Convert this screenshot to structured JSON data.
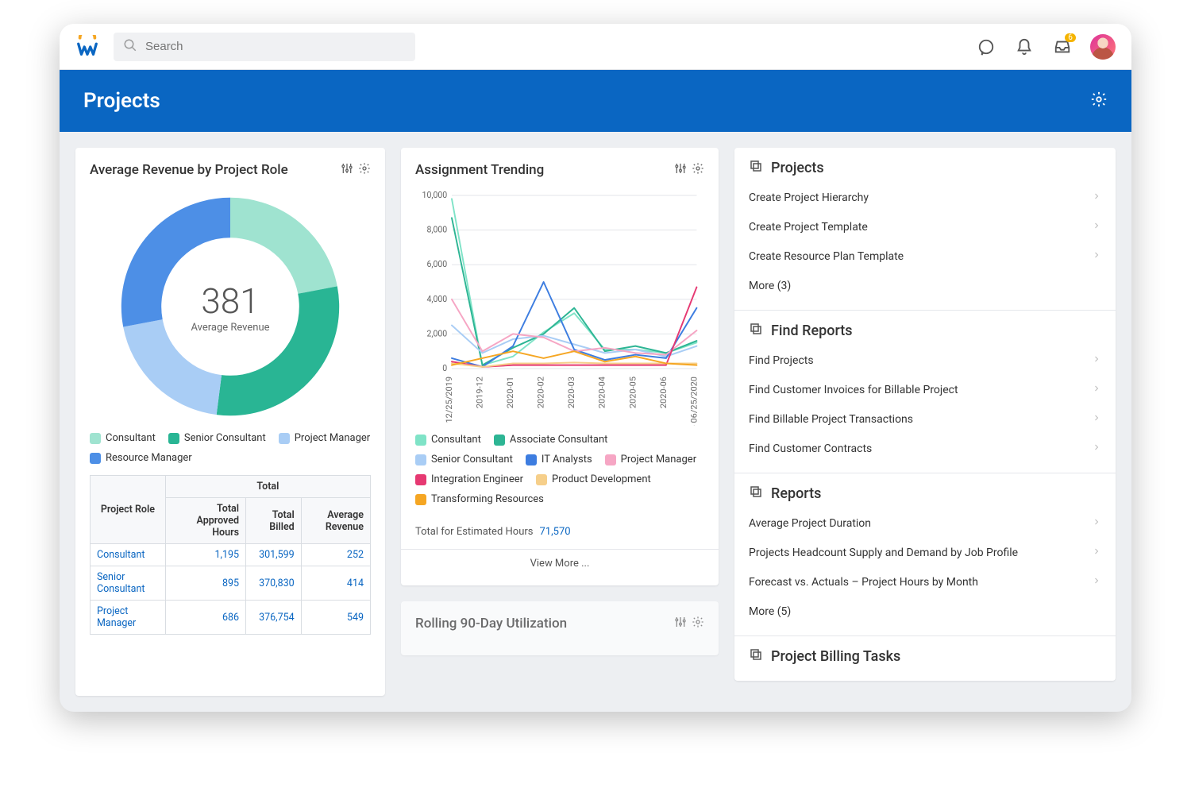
{
  "search": {
    "placeholder": "Search"
  },
  "topbar": {
    "inbox_badge": "6"
  },
  "header": {
    "title": "Projects"
  },
  "card_revenue": {
    "title": "Average Revenue by Project Role",
    "donut_value": "381",
    "donut_label": "Average Revenue",
    "legend": [
      {
        "label": "Consultant",
        "color": "#9fe3d0"
      },
      {
        "label": "Senior Consultant",
        "color": "#29b594"
      },
      {
        "label": "Project Manager",
        "color": "#a9cdf5"
      },
      {
        "label": "Resource Manager",
        "color": "#4d8fe6"
      }
    ],
    "table": {
      "group_header": "Total",
      "cols": [
        "Project Role",
        "Total Approved Hours",
        "Total Billed",
        "Average Revenue"
      ],
      "rows": [
        {
          "role": "Consultant",
          "hours": "1,195",
          "billed": "301,599",
          "rev": "252"
        },
        {
          "role": "Senior Consultant",
          "hours": "895",
          "billed": "370,830",
          "rev": "414"
        },
        {
          "role": "Project Manager",
          "hours": "686",
          "billed": "376,754",
          "rev": "549"
        }
      ]
    }
  },
  "card_trending": {
    "title": "Assignment Trending",
    "legend": [
      {
        "label": "Consultant",
        "color": "#7fe3c7"
      },
      {
        "label": "Associate Consultant",
        "color": "#2db594"
      },
      {
        "label": "Senior Consultant",
        "color": "#a9cdf5"
      },
      {
        "label": "IT Analysts",
        "color": "#3d7de0"
      },
      {
        "label": "Project Manager",
        "color": "#f6a6c4"
      },
      {
        "label": "Integration Engineer",
        "color": "#e63972"
      },
      {
        "label": "Product Development",
        "color": "#f6cf8a"
      },
      {
        "label": "Transforming Resources",
        "color": "#f5a623"
      }
    ],
    "total_label": "Total for Estimated Hours",
    "total_value": "71,570",
    "view_more": "View More ..."
  },
  "card_util": {
    "title": "Rolling 90-Day Utilization"
  },
  "right": {
    "sections": [
      {
        "title": "Projects",
        "items": [
          "Create Project Hierarchy",
          "Create Project Template",
          "Create Resource Plan Template",
          "More (3)"
        ]
      },
      {
        "title": "Find Reports",
        "items": [
          "Find Projects",
          "Find Customer Invoices for Billable Project",
          "Find Billable Project Transactions",
          "Find Customer Contracts"
        ]
      },
      {
        "title": "Reports",
        "items": [
          "Average Project Duration",
          "Projects Headcount Supply and Demand by Job Profile",
          "Forecast vs. Actuals – Project Hours by Month",
          "More (5)"
        ]
      },
      {
        "title": "Project Billing Tasks",
        "items": []
      }
    ]
  },
  "chart_data": [
    {
      "type": "pie",
      "title": "Average Revenue by Project Role",
      "center_value": 381,
      "center_label": "Average Revenue",
      "series": [
        {
          "name": "Consultant",
          "value": 22,
          "color": "#9fe3d0"
        },
        {
          "name": "Senior Consultant",
          "value": 30,
          "color": "#29b594"
        },
        {
          "name": "Project Manager",
          "value": 20,
          "color": "#a9cdf5"
        },
        {
          "name": "Resource Manager",
          "value": 28,
          "color": "#4d8fe6"
        }
      ]
    },
    {
      "type": "line",
      "title": "Assignment Trending",
      "xlabel": "",
      "ylabel": "",
      "ylim": [
        0,
        10000
      ],
      "yticks": [
        0,
        2000,
        4000,
        6000,
        8000,
        10000
      ],
      "categories": [
        "< 12/25/2019",
        "2019-12",
        "2020-01",
        "2020-02",
        "2020-03",
        "2020-04",
        "2020-05",
        "2020-06",
        "> 06/25/2020"
      ],
      "series": [
        {
          "name": "Consultant",
          "color": "#7fe3c7",
          "values": [
            9800,
            200,
            700,
            2100,
            3200,
            1100,
            1100,
            900,
            1500
          ]
        },
        {
          "name": "Associate Consultant",
          "color": "#2db594",
          "values": [
            8700,
            200,
            1200,
            2000,
            3500,
            1000,
            1300,
            900,
            1600
          ]
        },
        {
          "name": "Senior Consultant",
          "color": "#a9cdf5",
          "values": [
            2500,
            900,
            1700,
            1900,
            1400,
            900,
            1100,
            700,
            1300
          ]
        },
        {
          "name": "IT Analysts",
          "color": "#3d7de0",
          "values": [
            600,
            100,
            1300,
            5000,
            1100,
            500,
            800,
            600,
            3500
          ]
        },
        {
          "name": "Project Manager",
          "color": "#f6a6c4",
          "values": [
            4000,
            1000,
            2000,
            1800,
            1000,
            1200,
            900,
            800,
            2200
          ]
        },
        {
          "name": "Integration Engineer",
          "color": "#e63972",
          "values": [
            400,
            100,
            200,
            200,
            200,
            200,
            200,
            200,
            4700
          ]
        },
        {
          "name": "Product Development",
          "color": "#f6cf8a",
          "values": [
            300,
            100,
            300,
            300,
            350,
            300,
            300,
            300,
            300
          ]
        },
        {
          "name": "Transforming Resources",
          "color": "#f5a623",
          "values": [
            200,
            600,
            1000,
            600,
            1000,
            400,
            700,
            300,
            200
          ]
        }
      ],
      "total_label": "Total for Estimated Hours",
      "total_value": 71570
    }
  ]
}
